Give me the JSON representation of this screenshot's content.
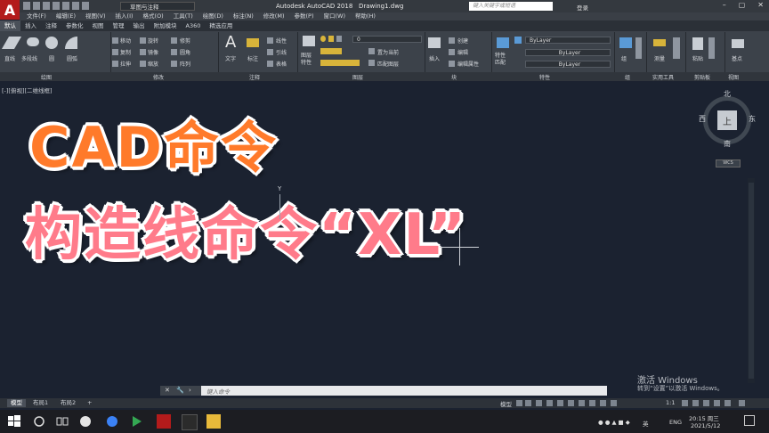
{
  "title_bar": {
    "logo": "A",
    "workspace": "草图与注释",
    "app_title": "Autodesk AutoCAD 2018",
    "file_name": "Drawing1.dwg",
    "search_placeholder": "键入关键字或短语",
    "login": "登录"
  },
  "menu": [
    "文件(F)",
    "编辑(E)",
    "视图(V)",
    "插入(I)",
    "格式(O)",
    "工具(T)",
    "绘图(D)",
    "标注(N)",
    "修改(M)",
    "参数(P)",
    "窗口(W)",
    "帮助(H)"
  ],
  "tabs": [
    "默认",
    "插入",
    "注释",
    "参数化",
    "视图",
    "管理",
    "输出",
    "附加模块",
    "A360",
    "精选应用"
  ],
  "ribbon": {
    "draw": {
      "line": "直线",
      "polyline": "多段线",
      "circle": "圆",
      "arc": "圆弧"
    },
    "modify": {
      "move": "移动",
      "rotate": "旋转",
      "trim": "修剪",
      "copy": "复制",
      "mirror": "镜像",
      "fillet": "圆角",
      "stretch": "拉伸",
      "scale": "缩放",
      "array": "阵列"
    },
    "annotation": {
      "text": "文字",
      "dimension": "标注",
      "linear": "线性",
      "leader": "引线",
      "table": "表格"
    },
    "layers": {
      "layer_props": "图层\n特性",
      "layer_value": "0",
      "make_current": "置为当前",
      "match_layer": "匹配图层"
    },
    "block": {
      "insert": "插入",
      "create": "创建",
      "edit": "编辑",
      "edit_attr": "编辑属性"
    },
    "properties": {
      "match": "特性\n匹配",
      "color": "ByLayer",
      "linetype": "ByLayer",
      "lineweight": "ByLayer"
    },
    "groups": {
      "group": "组"
    },
    "utilities": {
      "measure": "测量"
    },
    "clipboard": {
      "paste": "粘贴"
    },
    "base": {
      "base": "基点"
    },
    "panel_titles": [
      "绘图",
      "修改",
      "注释",
      "图层",
      "块",
      "特性",
      "组",
      "实用工具",
      "剪贴板",
      "视图"
    ]
  },
  "viewport": {
    "label": "[-][俯视][二维线框]",
    "headline_1": "CAD命令",
    "headline_2": "构造线命令“XL”",
    "ucs_y": "Y",
    "viewcube": {
      "north": "北",
      "south": "南",
      "east": "东",
      "west": "西",
      "top": "上",
      "wcs": "WCS"
    }
  },
  "command_line": {
    "placeholder": "键入命令"
  },
  "watermark": {
    "line1": "激活 Windows",
    "line2": "转到“设置”以激活 Windows。"
  },
  "layout_tabs": [
    "模型",
    "布局1",
    "布局2"
  ],
  "status_bar": {
    "mode": "模型",
    "scale": "1:1"
  },
  "taskbar": {
    "lang": "ENG",
    "time": "20:15 周三",
    "date": "2021/5/12",
    "input_method": "英"
  },
  "colors": {
    "headline_orange": "#ff7a2a",
    "headline_pink": "#ff7b8a",
    "canvas": "#1b2230",
    "autocad_red": "#b31b1b"
  }
}
